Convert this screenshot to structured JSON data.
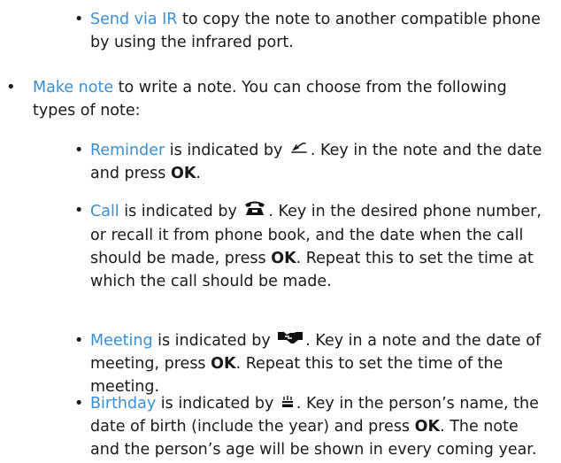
{
  "bullet_glyph": "•",
  "items": {
    "send_ir": {
      "link": "Send via IR",
      "text": " to copy the note to another compatible phone by using the infrared port."
    },
    "make_note": {
      "link": "Make note",
      "text": " to write a note. You can choose from the following types of note:"
    },
    "reminder": {
      "link": "Reminder",
      "text_a": " is indicated by ",
      "icon": "reminder-pen-icon",
      "text_b": ". Key in the note and the date and press ",
      "bold": "OK",
      "text_c": "."
    },
    "call": {
      "link": "Call",
      "text_a": " is indicated by ",
      "icon": "telephone-icon",
      "text_b": ". Key in the desired phone number, or recall it from phone book, and the date when the call should be made, press ",
      "bold_1": "OK",
      "text_c": ". Repeat this to set the time at which the call should be made."
    },
    "meeting": {
      "link": "Meeting",
      "text_a": " is indicated by ",
      "icon": "handshake-icon",
      "text_b": ". Key in a note and the date of meeting, press ",
      "bold": "OK",
      "text_c": ". Repeat this to set the time of the meeting."
    },
    "birthday": {
      "link": "Birthday",
      "text_a": " is indicated by ",
      "icon": "birthday-cake-icon",
      "text_b": ". Key in the person’s name, the date of birth (include the year) and press ",
      "bold": "OK",
      "text_c": ". The note and the person’s age will be shown in every coming year."
    }
  },
  "colors": {
    "link": "#3a8fd6",
    "text": "#1a1a1a"
  }
}
